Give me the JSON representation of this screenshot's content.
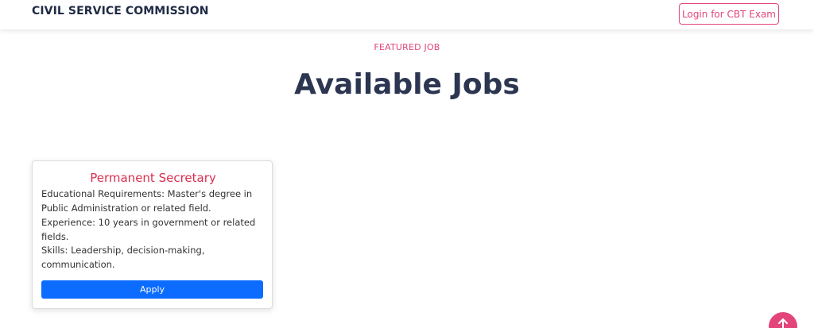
{
  "header": {
    "brand": "CIVIL SERVICE COMMISSION",
    "login_label": "Login for CBT Exam"
  },
  "hero": {
    "kicker": "FEATURED JOB",
    "title": "Available Jobs"
  },
  "jobs": [
    {
      "title": "Permanent Secretary",
      "education_label": "Educational Requirements:",
      "education_value": "Master's degree in Public Administration or related field.",
      "experience_label": "Experience:",
      "experience_value": "10 years in government or related fields.",
      "skills_label": "Skills:",
      "skills_value": "Leadership, decision-making, communication.",
      "apply_label": "Apply"
    }
  ],
  "colors": {
    "accent_pink": "#e3457b",
    "job_title_red": "#dc2f50",
    "apply_blue": "#0b6cff",
    "heading_navy": "#2c3651"
  },
  "icons": {
    "scroll_top": "arrow-up-icon"
  }
}
